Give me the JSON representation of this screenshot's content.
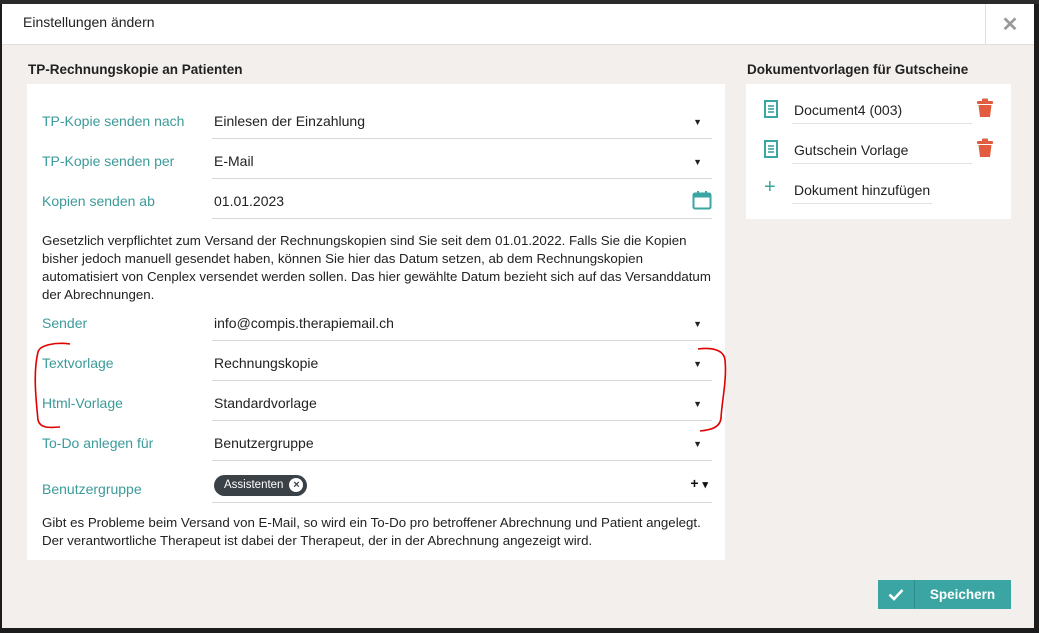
{
  "dialog": {
    "title": "Einstellungen ändern",
    "close_symbol": "✕"
  },
  "left": {
    "section_title": "TP-Rechnungskopie an Patienten",
    "rows": [
      {
        "label": "TP-Kopie senden nach",
        "value": "Einlesen der Einzahlung"
      },
      {
        "label": "TP-Kopie senden per",
        "value": "E-Mail"
      },
      {
        "label": "Kopien senden ab",
        "value": "01.01.2023"
      }
    ],
    "help1": "Gesetzlich verpflichtet zum Versand der Rechnungskopien sind Sie seit dem 01.01.2022. Falls Sie die Kopien bisher jedoch manuell gesendet haben, können Sie hier das Datum setzen, ab dem Rechnungskopien automatisiert von Cenplex versendet werden sollen. Das hier gewählte Datum bezieht sich auf das Versanddatum der Abrechnungen.",
    "rows2": [
      {
        "label": "Sender",
        "value": "info@compis.therapiemail.ch"
      },
      {
        "label": "Textvorlage",
        "value": "Rechnungskopie"
      },
      {
        "label": "Html-Vorlage",
        "value": "Standardvorlage"
      },
      {
        "label": "To-Do anlegen für",
        "value": "Benutzergruppe"
      }
    ],
    "group_row": {
      "label": "Benutzergruppe",
      "chip": "Assistenten",
      "chip_remove": "×",
      "add_symbol": "+",
      "caret": "▾"
    },
    "help2": "Gibt es Probleme beim Versand von E-Mail, so wird ein To-Do pro betroffener Abrechnung und Patient angelegt. Der verantwortliche Therapeut ist dabei der Therapeut, der in der Abrechnung angezeigt wird."
  },
  "right": {
    "section_title": "Dokumentvorlagen für Gutscheine",
    "docs": [
      "Document4 (003)",
      "Gutschein Vorlage"
    ],
    "add_label": "Dokument hinzufügen",
    "add_symbol": "+"
  },
  "footer": {
    "save_label": "Speichern"
  },
  "colors": {
    "label_teal": "#3b9b99",
    "button_teal": "#3aa5a2",
    "trash_red": "#e25c3f",
    "annotation_red": "#e00000"
  }
}
